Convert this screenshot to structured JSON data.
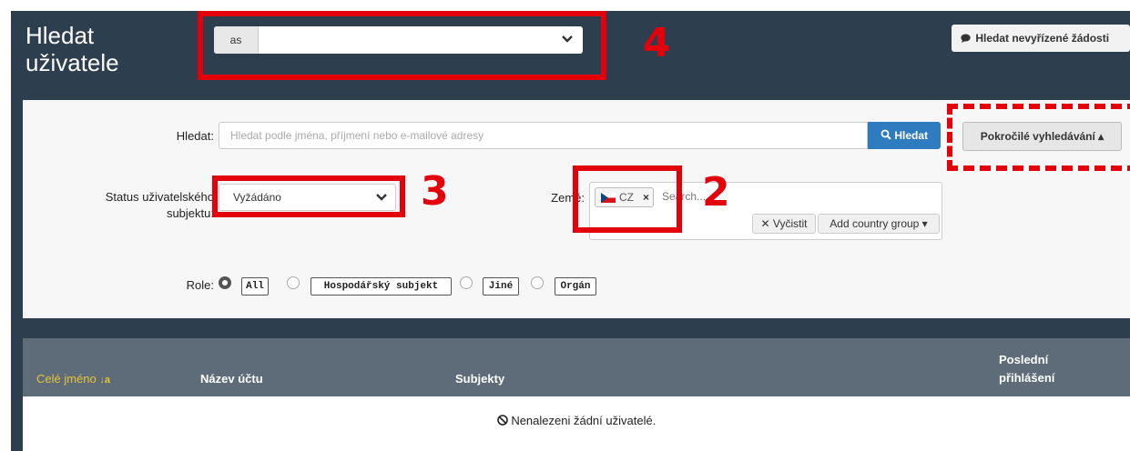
{
  "header": {
    "title_line1": "Hledat",
    "title_line2": "uživatele",
    "as_prefix": "as",
    "as_value": "",
    "pending_button": "Hledat nevyřízené žádosti"
  },
  "search": {
    "label": "Hledat:",
    "placeholder": "Hledat podle jména, příjmení nebo e-mailové adresy",
    "button": "Hledat",
    "advanced_button": "Pokročilé vyhledávání ▴"
  },
  "status": {
    "label_line1": "Status uživatelského",
    "label_line2": "subjektu:",
    "value": "Vyžádáno"
  },
  "country": {
    "label": "Země:",
    "chip_code": "CZ",
    "chip_remove": "×",
    "search_placeholder": "Search...",
    "clear_button": "✕ Vyčistit",
    "group_button": "Add country group ▾"
  },
  "role": {
    "label": "Role:",
    "options": [
      "All",
      "Hospodářský subjekt",
      "Jiné",
      "Orgán"
    ],
    "selected": "All"
  },
  "table": {
    "columns": [
      "Celé jméno",
      "Název účtu",
      "Subjekty",
      "Poslední",
      "přihlášení"
    ],
    "sort_indicator": "↓a",
    "empty_message": "Nenalezeni žádní uživatelé."
  },
  "annotations": {
    "label_2": "2",
    "label_3": "3",
    "label_4": "4",
    "color": "#e3000b"
  },
  "colors": {
    "background": "#2d3e4e",
    "accent_blue": "#2f7bbf",
    "sort_column": "#e8c33a"
  }
}
